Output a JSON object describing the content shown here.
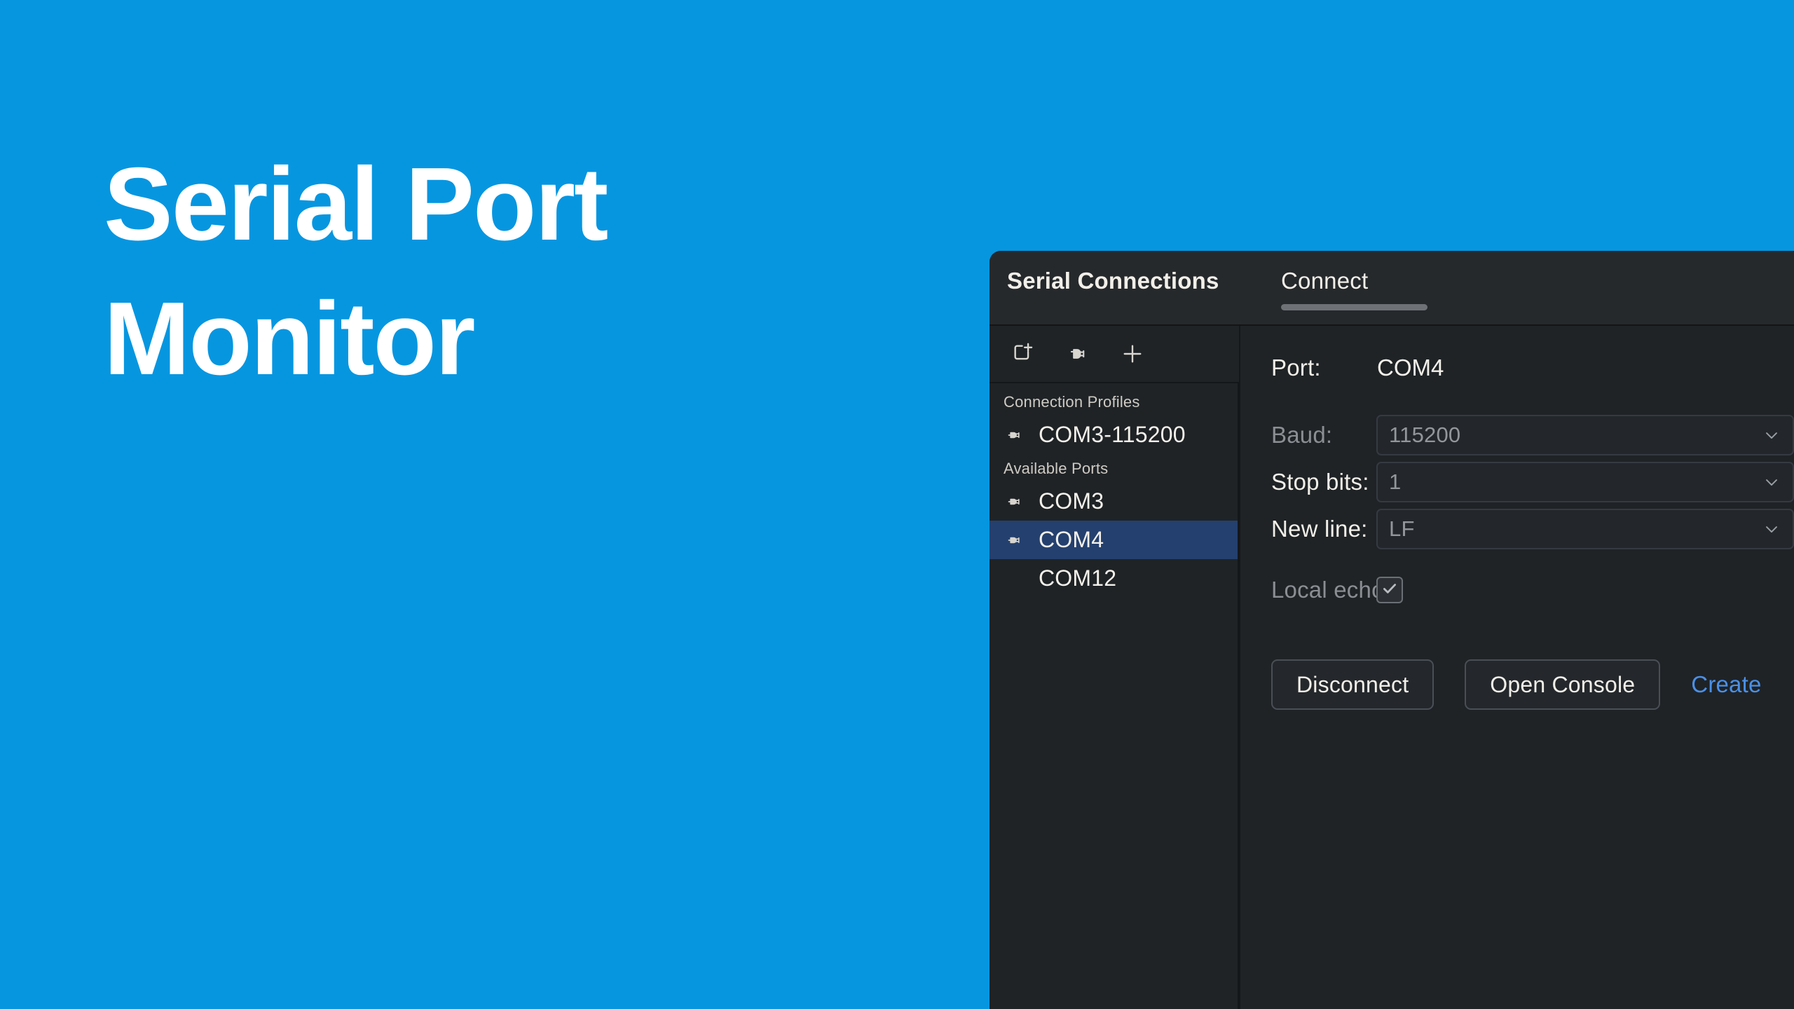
{
  "theme": {
    "brand_blue": "#0696e0",
    "panel_bg": "#1f2326",
    "header_bg": "#26292c",
    "selection_blue": "#24406e",
    "link_blue": "#4a90e8",
    "text_primary": "#f2efe9",
    "text_dim": "#8b8f93"
  },
  "hero": {
    "title": "Serial Port\nMonitor"
  },
  "window": {
    "title": "Serial Connections",
    "tabs": [
      {
        "label": "Connect",
        "active": true
      }
    ]
  },
  "sidebar": {
    "toolbar": [
      {
        "name": "new-connection-icon",
        "tooltip": "New connection"
      },
      {
        "name": "serial-plug-icon",
        "tooltip": "Serial port"
      },
      {
        "name": "plus-icon",
        "tooltip": "Add"
      }
    ],
    "groups": [
      {
        "label": "Connection Profiles",
        "items": [
          {
            "label": "COM3-115200",
            "icon": "serial-plug-icon",
            "selected": false
          }
        ]
      },
      {
        "label": "Available Ports",
        "items": [
          {
            "label": "COM3",
            "icon": "serial-plug-icon",
            "selected": false
          },
          {
            "label": "COM4",
            "icon": "serial-plug-icon",
            "selected": true
          },
          {
            "label": "COM12",
            "icon": "none",
            "selected": false
          }
        ]
      }
    ]
  },
  "form": {
    "port": {
      "label": "Port:",
      "value": "COM4"
    },
    "baud": {
      "label": "Baud:",
      "value": "115200"
    },
    "stop_bits": {
      "label": "Stop bits:",
      "value": "1"
    },
    "new_line": {
      "label": "New line:",
      "value": "LF"
    },
    "local_echo": {
      "label": "Local echo:",
      "checked": true
    }
  },
  "actions": {
    "disconnect": "Disconnect",
    "open_console": "Open Console",
    "create_link": "Create"
  }
}
